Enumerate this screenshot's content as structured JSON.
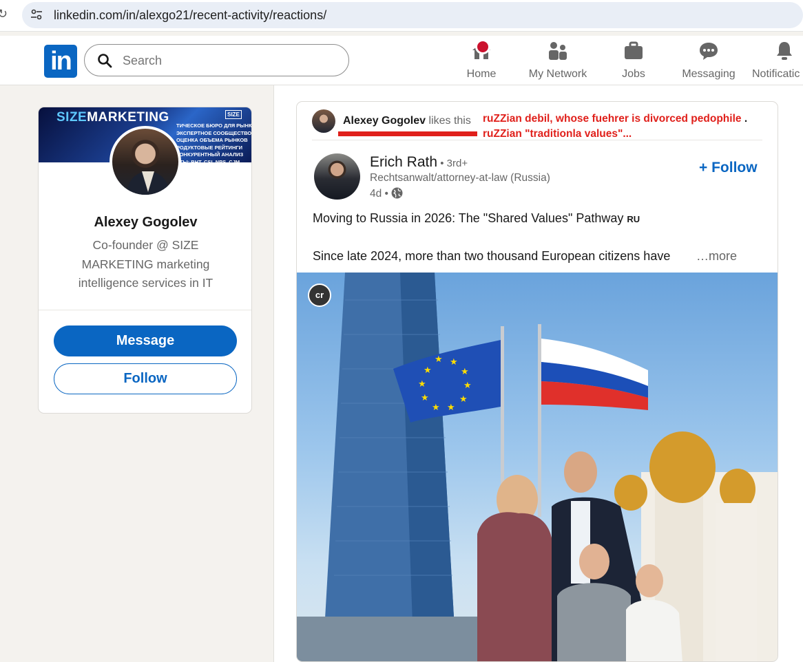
{
  "browser": {
    "url": "linkedin.com/in/alexgo21/recent-activity/reactions/"
  },
  "nav": {
    "logo": "in",
    "search_placeholder": "Search",
    "items": [
      {
        "label": "Home",
        "icon": "home-icon"
      },
      {
        "label": "My Network",
        "icon": "network-icon"
      },
      {
        "label": "Jobs",
        "icon": "briefcase-icon"
      },
      {
        "label": "Messaging",
        "icon": "messaging-icon"
      },
      {
        "label": "Notificatic",
        "icon": "bell-icon"
      }
    ],
    "accent": "#0a66c2",
    "badge_color": "#cb112d"
  },
  "profile": {
    "banner_brand_a": "SIZE",
    "banner_brand_b": "MARKETING",
    "banner_tag": "SIZE",
    "banner_lines": [
      "ТИЧЕСКОЕ БЮРО ДЛЯ РЫНКА IT",
      "ЭКСПЕРТНОЕ СООБЩЕСТВО",
      "ОЦЕНКА ОБЪЕМА РЫНКОВ",
      "РОДУКТОВЫЕ РЕЙТИНГИ",
      "КОНКУРЕНТНЫЙ АНАЛИЗ",
      "КТЫ: BHT, CSI, NPS, CJM"
    ],
    "name": "Alexey Gogolev",
    "headline": "Co-founder @ SIZE MARKETING marketing intelligence services in IT",
    "message_label": "Message",
    "follow_label": "Follow"
  },
  "post": {
    "liker_name": "Alexey Gogolev",
    "liker_action": " likes this",
    "annotation_line1": "ruZZian debil, whose fuehrer is divorced pedophile",
    "annotation_dot": ".",
    "annotation_line2": "ruZZian \"traditionla values\"...",
    "annotation_color": "#e0201b",
    "author_name": "Erich Rath",
    "author_degree": " • 3rd+",
    "author_headline": "Rechtsanwalt/attorney-at-law (Russia)",
    "post_time": "4d • ",
    "follow_label": "+ Follow",
    "text_line1": "Moving to Russia in 2026: The \"Shared Values\" Pathway",
    "text_flag": "RU",
    "text_line2": "Since late 2024, more than two thousand European citizens have",
    "more_label": "…more",
    "image_badge": "cr"
  }
}
